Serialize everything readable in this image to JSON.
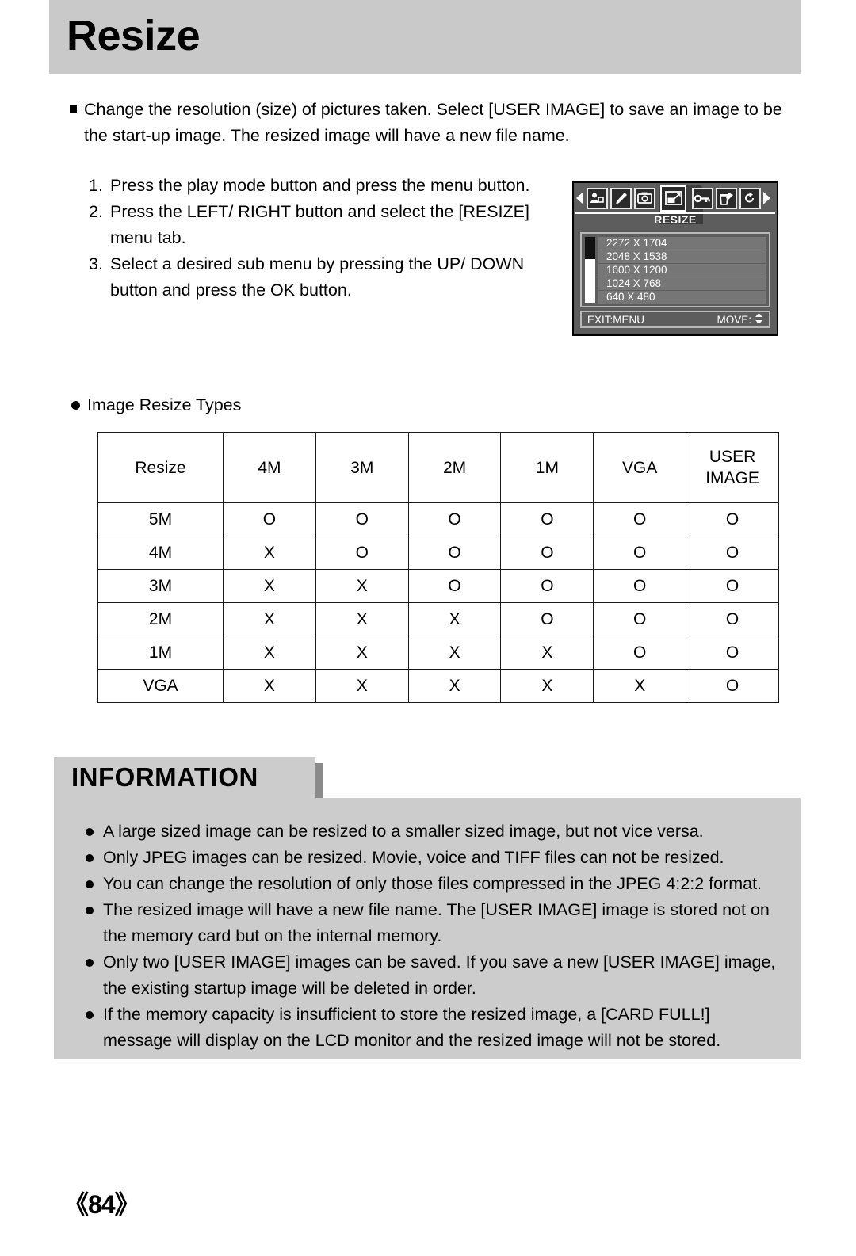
{
  "page": {
    "title": "Resize",
    "number": "《84》"
  },
  "intro": {
    "bullet_icon": "square-bullet",
    "line1": "Change the resolution (size) of pictures taken. Select [USER IMAGE]  to save an image to be",
    "line2": "the start-up image. The resized image will have a new file name."
  },
  "steps": [
    {
      "num": "1.",
      "text": "Press the play mode button and press the menu button."
    },
    {
      "num": "2.",
      "text": "Press the LEFT/ RIGHT button and select the [RESIZE] menu tab."
    },
    {
      "num": "3.",
      "text": "Select a desired sub menu by pressing the UP/ DOWN button and press the OK button."
    }
  ],
  "lcd": {
    "menu_title": "RESIZE",
    "tabs": [
      {
        "icon": "left-arrow-icon",
        "name": "prev-tabs-arrow"
      },
      {
        "icon": "portrait-photo-icon",
        "name": "tab-user-image"
      },
      {
        "icon": "brush-icon",
        "name": "tab-effect"
      },
      {
        "icon": "camera-icon",
        "name": "tab-dpof"
      },
      {
        "icon": "resize-icon",
        "name": "tab-resize",
        "selected": true
      },
      {
        "icon": "key-icon",
        "name": "tab-protect"
      },
      {
        "icon": "trash-brush-icon",
        "name": "tab-delete"
      },
      {
        "icon": "rotate-icon",
        "name": "tab-rotate"
      },
      {
        "icon": "right-arrow-icon",
        "name": "next-tabs-arrow"
      }
    ],
    "items": [
      "2272 X 1704",
      "2048 X 1538",
      "1600 X 1200",
      "1024 X 768",
      "640 X 480"
    ],
    "footer_left": "EXIT:MENU",
    "footer_right": "MOVE:",
    "footer_right_icon": "up-down-arrow-icon"
  },
  "types_section": {
    "bullet_icon": "round-bullet",
    "heading": "Image Resize Types"
  },
  "chart_data": {
    "type": "table",
    "title": "Image Resize Types",
    "columns": [
      "Resize",
      "4M",
      "3M",
      "2M",
      "1M",
      "VGA",
      "USER IMAGE"
    ],
    "column_header_lines": [
      [
        "Resize"
      ],
      [
        "4M"
      ],
      [
        "3M"
      ],
      [
        "2M"
      ],
      [
        "1M"
      ],
      [
        "VGA"
      ],
      [
        "USER",
        "IMAGE"
      ]
    ],
    "rows": [
      {
        "label": "5M",
        "values": [
          "O",
          "O",
          "O",
          "O",
          "O",
          "O"
        ]
      },
      {
        "label": "4M",
        "values": [
          "X",
          "O",
          "O",
          "O",
          "O",
          "O"
        ]
      },
      {
        "label": "3M",
        "values": [
          "X",
          "X",
          "O",
          "O",
          "O",
          "O"
        ]
      },
      {
        "label": "2M",
        "values": [
          "X",
          "X",
          "X",
          "O",
          "O",
          "O"
        ]
      },
      {
        "label": "1M",
        "values": [
          "X",
          "X",
          "X",
          "X",
          "O",
          "O"
        ]
      },
      {
        "label": "VGA",
        "values": [
          "X",
          "X",
          "X",
          "X",
          "X",
          "O"
        ]
      }
    ]
  },
  "information": {
    "heading": "INFORMATION",
    "items": [
      {
        "line1": "A large sized image can be resized to a smaller sized image, but not vice versa.",
        "line2": ""
      },
      {
        "line1": "Only JPEG images can be resized. Movie, voice and TIFF files can not be resized.",
        "line2": ""
      },
      {
        "line1": "You can change the resolution of only those files compressed in the JPEG 4:2:2 format.",
        "line2": ""
      },
      {
        "line1": "The resized image will have a new file name. The [USER IMAGE] image is stored not on",
        "line2": "the memory card but on the internal memory."
      },
      {
        "line1": "Only two [USER IMAGE] images can be saved. If you save a new [USER IMAGE] image,",
        "line2": "the existing startup image will be deleted in order."
      },
      {
        "line1": "If the memory capacity is insufficient to store the resized image, a [CARD FULL!]",
        "line2": "message will display on the LCD monitor and the resized image will not be stored."
      }
    ]
  },
  "colors": {
    "title_band": "#c9c9c9",
    "info_panel": "#cccccc",
    "info_shadow": "#8a8a8a",
    "lcd_body": "#5d5d5d",
    "lcd_item": "#767676",
    "lcd_tab_dark": "#2b2b2b"
  }
}
